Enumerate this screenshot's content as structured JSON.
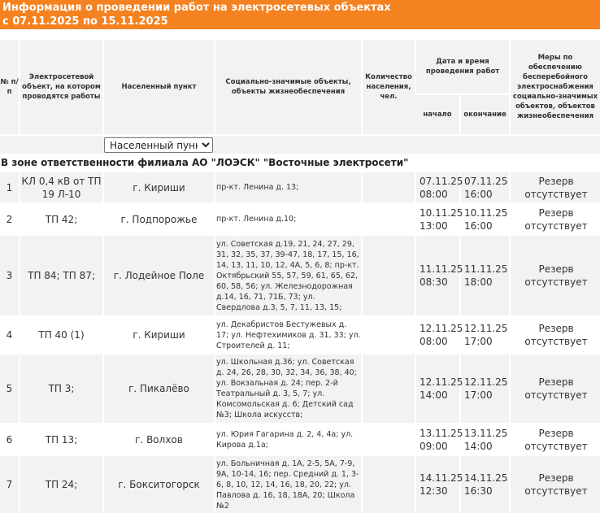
{
  "banner": {
    "line1": "Информация о проведении работ на электросетевых объектах",
    "line2": "с 07.11.2025 по 15.11.2025"
  },
  "headers": {
    "num": "№ п/п",
    "object": "Электросетевой объект, на котором проводятся работы",
    "locality": "Населенный пункт",
    "social": "Социально-значимые объекты, объекты жизнеобеспечения",
    "population": "Количество населения, чел.",
    "datetime": "Дата и время проведения работ",
    "start": "начало",
    "end": "окончание",
    "measures": "Меры по обеспечению бесперебойного электроснабжения социально-значимых объектов, объектов жизнеобеспечения"
  },
  "filter": {
    "selected": "Населенный пункт"
  },
  "section_title": "В зоне ответственности филиала АО \"ЛОЭСК\" \"Восточные электросети\"",
  "rows": [
    {
      "num": "1",
      "object": "КЛ 0,4 кВ от ТП 19 Л-10",
      "locality": "г. Кириши",
      "social": "пр-кт. Ленина д. 13;",
      "population": "",
      "start_date": "07.11.25",
      "start_time": "08:00",
      "end_date": "07.11.25",
      "end_time": "16:00",
      "measures": "Резерв отсутствует"
    },
    {
      "num": "2",
      "object": "ТП 42;",
      "locality": "г. Подпорожье",
      "social": "пр-кт. Ленина д.10;",
      "population": "",
      "start_date": "10.11.25",
      "start_time": "13:00",
      "end_date": "10.11.25",
      "end_time": "16:00",
      "measures": "Резерв отсутствует"
    },
    {
      "num": "3",
      "object": "ТП 84; ТП 87;",
      "locality": "г. Лодейное Поле",
      "social": "ул. Советская д.19, 21, 24, 27, 29, 31, 32, 35, 37, 39-47, 18, 17, 15, 16, 14, 13, 11, 10, 12, 4А, 5, 6, 8; пр-кт. Октябрьский 55, 57, 59, 61, 65, 62, 60, 58, 56; ул. Железнодорожная д.14, 16, 71, 71Б, 73; ул. Свердлова д.3, 5, 7, 11, 13, 15;",
      "population": "",
      "start_date": "11.11.25",
      "start_time": "08:30",
      "end_date": "11.11.25",
      "end_time": "18:00",
      "measures": "Резерв отсутствует"
    },
    {
      "num": "4",
      "object": "ТП 40 (1)",
      "locality": "г. Кириши",
      "social": "ул. Декабристов Бестужевых д. 17; ул. Нефтехимиков д. 31, 33; ул. Строителей д. 11;",
      "population": "",
      "start_date": "12.11.25",
      "start_time": "08:00",
      "end_date": "12.11.25",
      "end_time": "17:00",
      "measures": "Резерв отсутствует"
    },
    {
      "num": "5",
      "object": "ТП 3;",
      "locality": "г. Пикалёво",
      "social": "ул. Школьная д.36; ул. Советская д. 24, 26, 28, 30, 32, 34, 36, 38, 40; ул. Вокзальная д. 24; пер. 2-й Театральный д. 3, 5, 7; ул. Комсомольская д. 6; Детский сад №3; Школа искусств;",
      "population": "",
      "start_date": "12.11.25",
      "start_time": "14:00",
      "end_date": "12.11.25",
      "end_time": "17:00",
      "measures": "Резерв отсутствует"
    },
    {
      "num": "6",
      "object": "ТП 13;",
      "locality": "г. Волхов",
      "social": "ул. Юрия Гагарина д. 2, 4, 4а; ул. Кирова д.1а;",
      "population": "",
      "start_date": "13.11.25",
      "start_time": "09:00",
      "end_date": "13.11.25",
      "end_time": "14:00",
      "measures": "Резерв отсутствует"
    },
    {
      "num": "7",
      "object": "ТП 24;",
      "locality": "г. Бокситогорск",
      "social": "ул. Больничная д. 1А, 2-5, 5А, 7-9, 9А, 10-14, 16; пер. Средний д. 1, 3-6, 8, 10, 12, 14, 16, 18, 20, 22; ул. Павлова д. 16, 18, 18А, 20; Школа №2",
      "population": "",
      "start_date": "14.11.25",
      "start_time": "12:30",
      "end_date": "14.11.25",
      "end_time": "16:30",
      "measures": "Резерв отсутствует"
    }
  ]
}
